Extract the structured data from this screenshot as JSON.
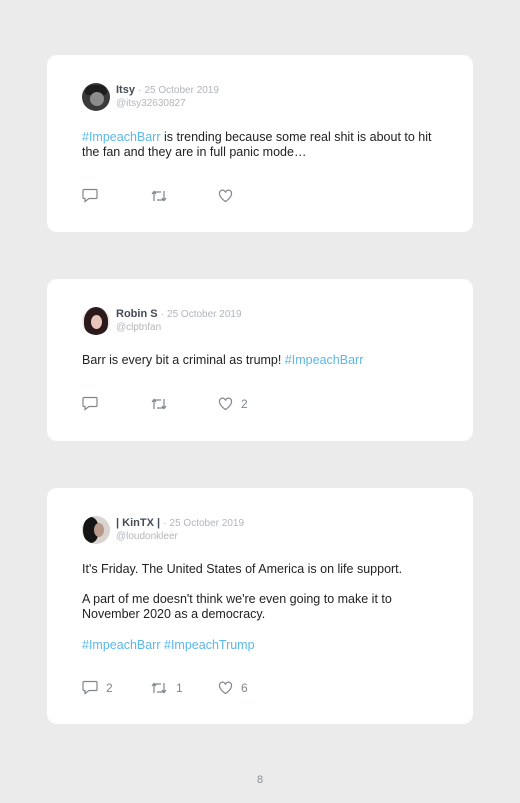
{
  "tweets": [
    {
      "author": "Itsy",
      "separator": "·",
      "date": "25 October 2019",
      "handle": "@itsy32630827",
      "text_tag": "#ImpeachBarr",
      "text_rest": " is trending because some real shit is about to hit the fan and they are in full panic mode…",
      "replies": "",
      "retweets": "",
      "likes": ""
    },
    {
      "author": "Robin S",
      "separator": "·",
      "date": "25 October 2019",
      "handle": "@clptnfan",
      "text_main": "Barr is every bit a criminal as trump! ",
      "text_tag": "#ImpeachBarr",
      "replies": "",
      "retweets": "",
      "likes": "2"
    },
    {
      "author": "| KinTX |",
      "separator": "·",
      "date": "25 October 2019",
      "handle": "@loudonkleer",
      "para1": "It's Friday. The United States of America is on life support.",
      "para2": "A part of me doesn't think we're even going to make it to November 2020 as a democracy.",
      "tag1": "#ImpeachBarr",
      "tag2": "#ImpeachTrump",
      "replies": "2",
      "retweets": "1",
      "likes": "6"
    }
  ],
  "icons": [
    "reply-icon",
    "retweet-icon",
    "like-icon"
  ],
  "colors": {
    "hashtag": "#5bb8e8",
    "meta": "#b0b6bb",
    "card": "#ffffff",
    "page": "#ebebeb"
  },
  "page_number": "8"
}
